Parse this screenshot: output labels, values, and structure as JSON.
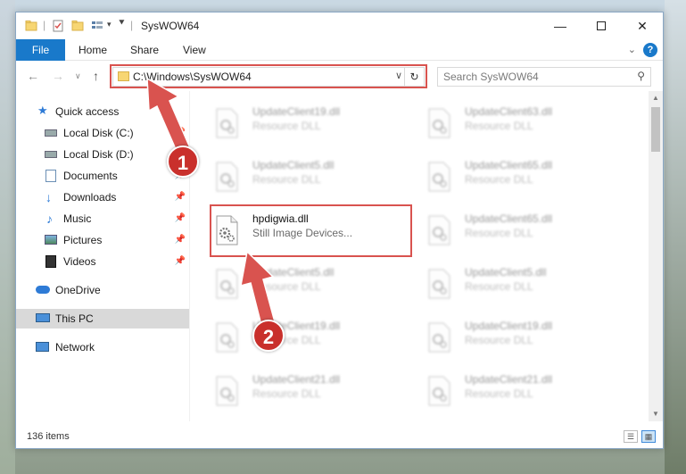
{
  "window": {
    "title": "SysWOW64"
  },
  "ribbon": {
    "tabs": [
      "File",
      "Home",
      "Share",
      "View"
    ]
  },
  "navigation": {
    "address": "C:\\Windows\\SysWOW64",
    "search_placeholder": "Search SysWOW64"
  },
  "sidebar": {
    "items": [
      {
        "label": "Quick access",
        "icon": "star-icon"
      },
      {
        "label": "Local Disk (C:)",
        "icon": "drive-icon"
      },
      {
        "label": "Local Disk (D:)",
        "icon": "drive-icon"
      },
      {
        "label": "Documents",
        "icon": "documents-icon"
      },
      {
        "label": "Downloads",
        "icon": "download-icon"
      },
      {
        "label": "Music",
        "icon": "music-icon"
      },
      {
        "label": "Pictures",
        "icon": "pictures-icon"
      },
      {
        "label": "Videos",
        "icon": "videos-icon"
      },
      {
        "label": "OneDrive",
        "icon": "cloud-icon"
      },
      {
        "label": "This PC",
        "icon": "computer-icon"
      },
      {
        "label": "Network",
        "icon": "network-icon"
      }
    ]
  },
  "files": {
    "left": [
      {
        "name": "UpdateClient19.dll",
        "type": "Resource DLL"
      },
      {
        "name": "UpdateClient5.dll",
        "type": "Resource DLL"
      },
      {
        "name": "hpdigwia.dll",
        "type": "Still Image Devices..."
      },
      {
        "name": "UpdateClient5.dll",
        "type": "Resource DLL"
      },
      {
        "name": "UpdateClient19.dll",
        "type": "Resource DLL"
      },
      {
        "name": "UpdateClient21.dll",
        "type": "Resource DLL"
      }
    ],
    "right": [
      {
        "name": "UpdateClient63.dll",
        "type": "Resource DLL"
      },
      {
        "name": "UpdateClient65.dll",
        "type": "Resource DLL"
      },
      {
        "name": "UpdateClient65.dll",
        "type": "Resource DLL"
      },
      {
        "name": "UpdateClient5.dll",
        "type": "Resource DLL"
      },
      {
        "name": "UpdateClient19.dll",
        "type": "Resource DLL"
      },
      {
        "name": "UpdateClient21.dll",
        "type": "Resource DLL"
      }
    ]
  },
  "status": {
    "item_count": "136 items"
  },
  "annotations": {
    "step1": "1",
    "step2": "2",
    "color": "#d9534f"
  }
}
